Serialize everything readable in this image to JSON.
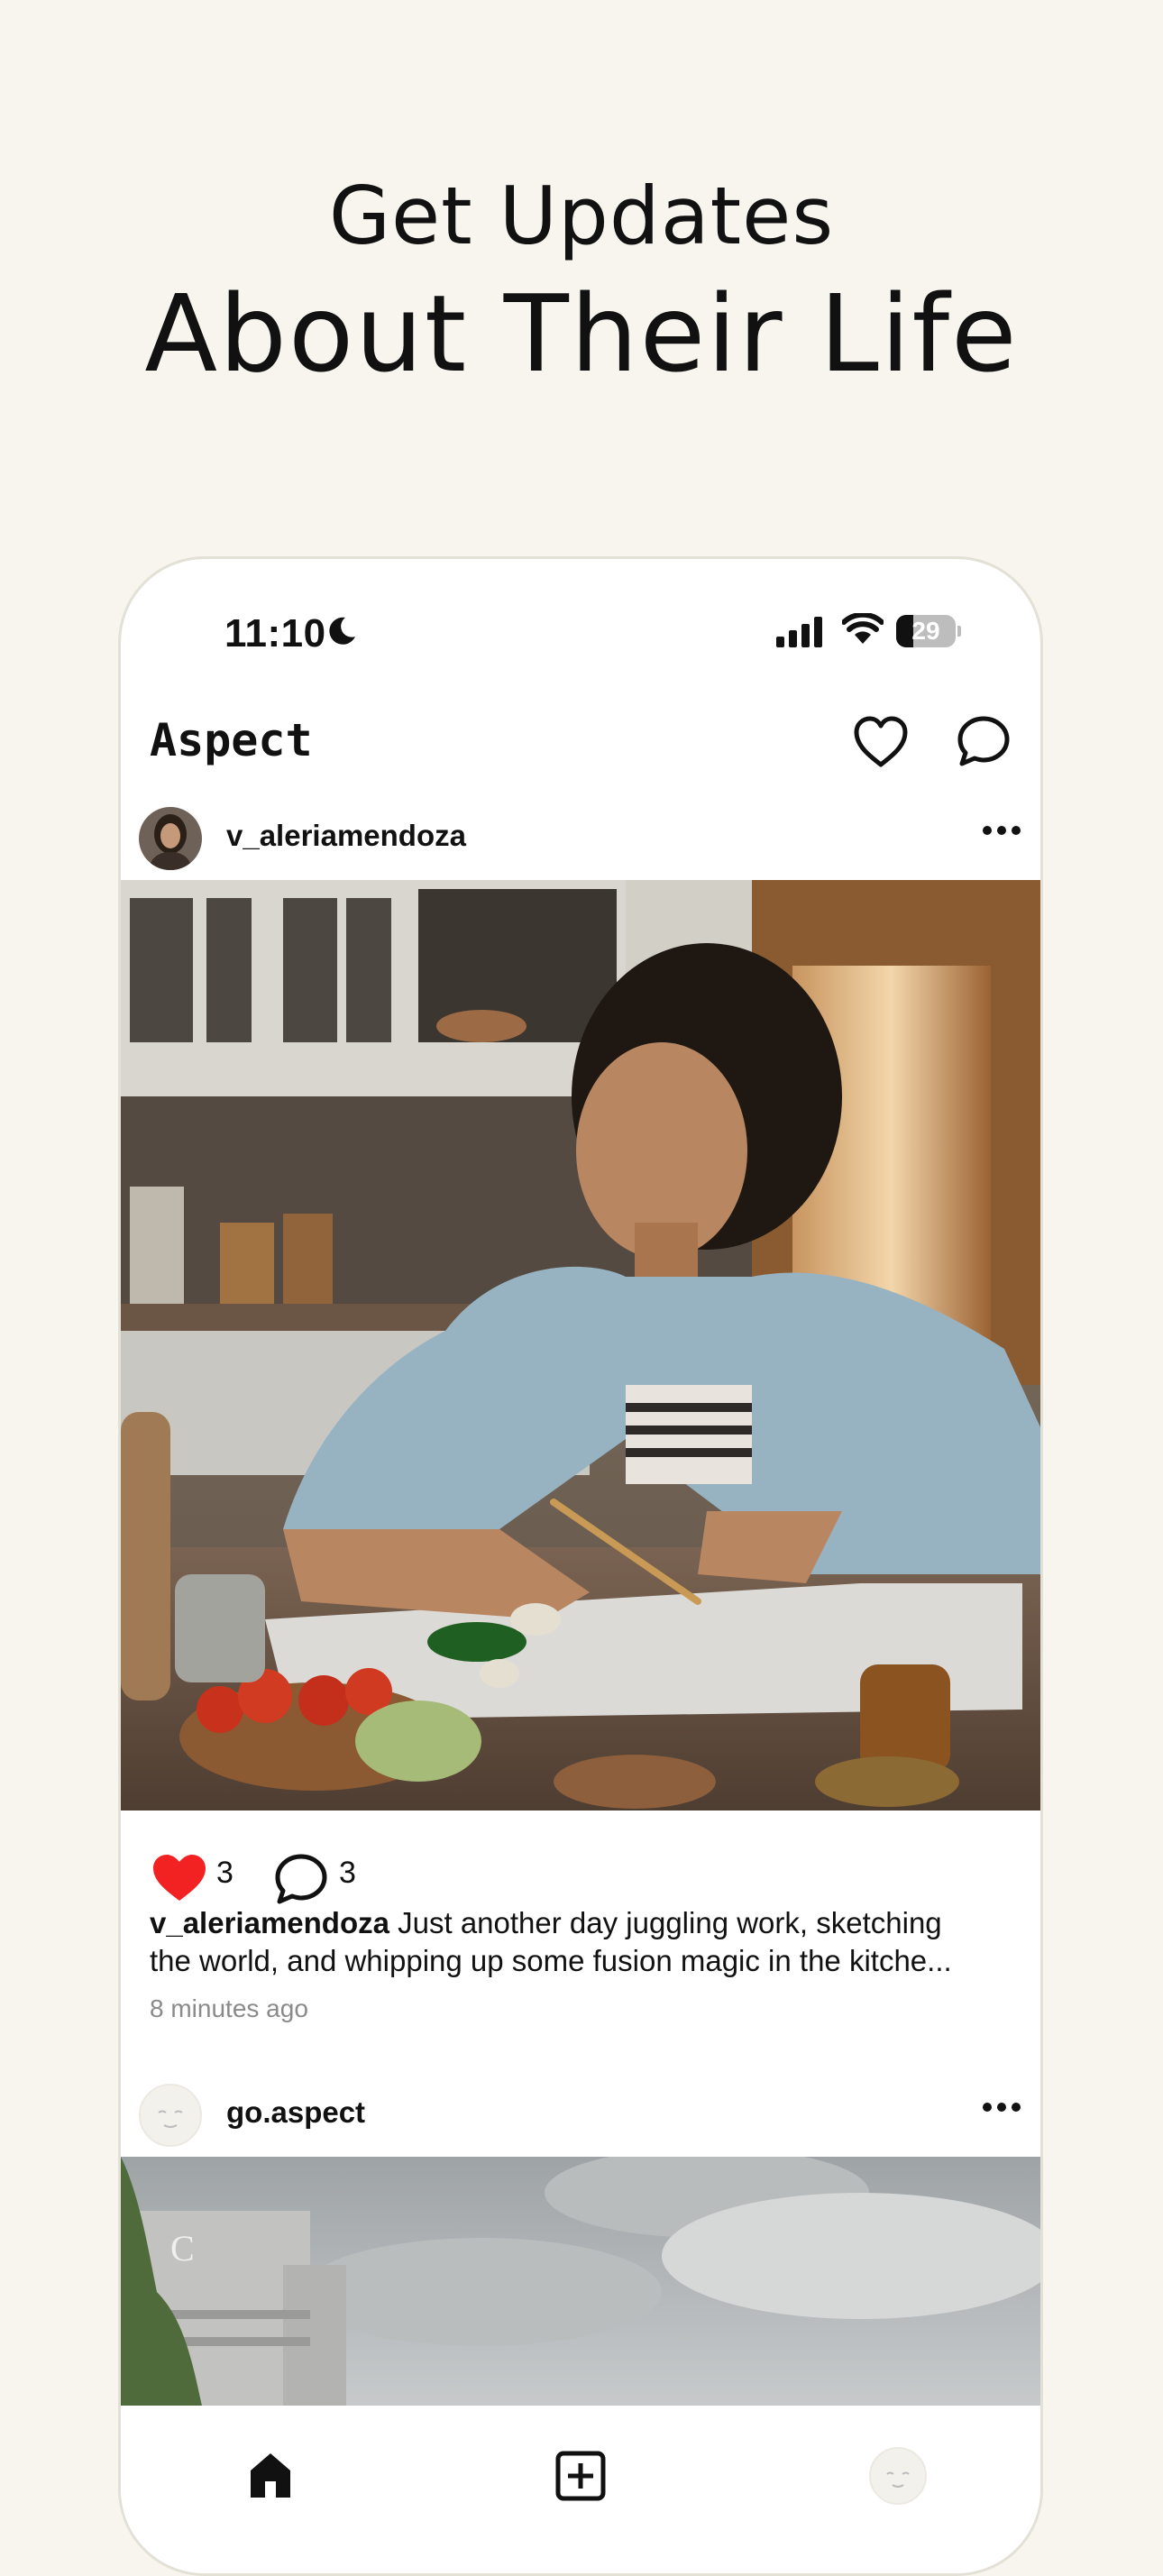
{
  "hero": {
    "line1": "Get Updates",
    "line2": "About Their Life"
  },
  "status_bar": {
    "time": "11:10",
    "battery_percent": 29,
    "battery_label": "29",
    "icons": [
      "moon-icon",
      "cellular-signal-icon",
      "wifi-icon",
      "battery-icon"
    ]
  },
  "app": {
    "title": "Aspect",
    "header_icons": [
      "heart-icon",
      "chat-bubble-icon"
    ]
  },
  "posts": [
    {
      "username": "v_aleriamendoza",
      "likes": "3",
      "comments": "3",
      "caption_user": "v_aleriamendoza",
      "caption_line1": "Just another day juggling work, sketching",
      "caption_line2": "the world, and whipping up some fusion magic in the kitche...",
      "time_ago": "8 minutes ago"
    },
    {
      "username": "go.aspect"
    }
  ],
  "tab_bar": {
    "items": [
      "home-icon",
      "add-post-icon",
      "profile-avatar"
    ]
  },
  "colors": {
    "background": "#f7f5ee",
    "like_red": "#f22222",
    "text": "#111111",
    "muted": "#8a8a8a"
  }
}
